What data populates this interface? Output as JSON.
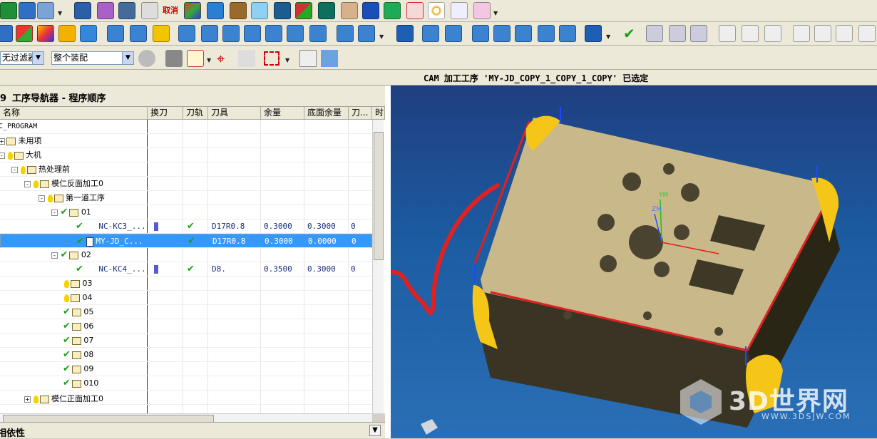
{
  "toolbar3": {
    "filter_value": "无过滤器",
    "assembly_value": "整个装配"
  },
  "status_text": "CAM 加工工序 'MY-JD_COPY_1_COPY_1_COPY' 已选定",
  "navigator": {
    "title": "工序导航器 - 程序顺序",
    "title_prefix": "9",
    "columns": [
      "名称",
      "换刀",
      "刀轨",
      "刀具",
      "余量",
      "底面余量",
      "刀...",
      "时"
    ],
    "rows": [
      {
        "name": "NC_PROGRAM",
        "tool_change": "",
        "toolpath": "",
        "tool": "",
        "stock": "",
        "floor_stock": "",
        "tool_no": "",
        "selected": false
      },
      {
        "name": "未用项",
        "tool_change": "",
        "toolpath": "",
        "tool": "",
        "stock": "",
        "floor_stock": "",
        "tool_no": "",
        "selected": false
      },
      {
        "name": "大机",
        "tool_change": "",
        "toolpath": "",
        "tool": "",
        "stock": "",
        "floor_stock": "",
        "tool_no": "",
        "selected": false
      },
      {
        "name": "热处理前",
        "tool_change": "",
        "toolpath": "",
        "tool": "",
        "stock": "",
        "floor_stock": "",
        "tool_no": "",
        "selected": false
      },
      {
        "name": "模仁反面加工0",
        "tool_change": "",
        "toolpath": "",
        "tool": "",
        "stock": "",
        "floor_stock": "",
        "tool_no": "",
        "selected": false
      },
      {
        "name": "第一道工序",
        "tool_change": "",
        "toolpath": "",
        "tool": "",
        "stock": "",
        "floor_stock": "",
        "tool_no": "",
        "selected": false
      },
      {
        "name": "01",
        "tool_change": "",
        "toolpath": "",
        "tool": "",
        "stock": "",
        "floor_stock": "",
        "tool_no": "",
        "selected": false
      },
      {
        "name": "NC-KC3_...",
        "tool_change": "",
        "toolpath": "✔",
        "tool": "D17R0.8",
        "stock": "0.3000",
        "floor_stock": "0.3000",
        "tool_no": "0",
        "selected": false
      },
      {
        "name": "MY-JD_C...",
        "tool_change": "",
        "toolpath": "✔",
        "tool": "D17R0.8",
        "stock": "0.3000",
        "floor_stock": "0.0000",
        "tool_no": "0",
        "selected": true
      },
      {
        "name": "02",
        "tool_change": "",
        "toolpath": "",
        "tool": "",
        "stock": "",
        "floor_stock": "",
        "tool_no": "",
        "selected": false
      },
      {
        "name": "NC-KC4_...",
        "tool_change": "",
        "toolpath": "✔",
        "tool": "D8.",
        "stock": "0.3500",
        "floor_stock": "0.3000",
        "tool_no": "0",
        "selected": false
      },
      {
        "name": "03",
        "tool_change": "",
        "toolpath": "",
        "tool": "",
        "stock": "",
        "floor_stock": "",
        "tool_no": "",
        "selected": false
      },
      {
        "name": "04",
        "tool_change": "",
        "toolpath": "",
        "tool": "",
        "stock": "",
        "floor_stock": "",
        "tool_no": "",
        "selected": false
      },
      {
        "name": "05",
        "tool_change": "",
        "toolpath": "",
        "tool": "",
        "stock": "",
        "floor_stock": "",
        "tool_no": "",
        "selected": false
      },
      {
        "name": "06",
        "tool_change": "",
        "toolpath": "",
        "tool": "",
        "stock": "",
        "floor_stock": "",
        "tool_no": "",
        "selected": false
      },
      {
        "name": "07",
        "tool_change": "",
        "toolpath": "",
        "tool": "",
        "stock": "",
        "floor_stock": "",
        "tool_no": "",
        "selected": false
      },
      {
        "name": "08",
        "tool_change": "",
        "toolpath": "",
        "tool": "",
        "stock": "",
        "floor_stock": "",
        "tool_no": "",
        "selected": false
      },
      {
        "name": "09",
        "tool_change": "",
        "toolpath": "",
        "tool": "",
        "stock": "",
        "floor_stock": "",
        "tool_no": "",
        "selected": false
      },
      {
        "name": "010",
        "tool_change": "",
        "toolpath": "",
        "tool": "",
        "stock": "",
        "floor_stock": "",
        "tool_no": "",
        "selected": false
      },
      {
        "name": "模仁正面加工0",
        "tool_change": "",
        "toolpath": "",
        "tool": "",
        "stock": "",
        "floor_stock": "",
        "tool_no": "",
        "selected": false
      }
    ]
  },
  "dependencies_label": "相依性",
  "viewport": {
    "axis_labels": {
      "ym": "YM",
      "zm": "ZM"
    }
  },
  "watermark": {
    "main": "3D世界网",
    "sub": "WWW.3DSJW.COM"
  },
  "colors": {
    "selection": "#3399ff",
    "check": "#1aa11a",
    "part_top": "#c9b88a",
    "viewport_bg": "#1c5ca2",
    "boundary": "#e02020",
    "clamp": "#f5c518"
  }
}
